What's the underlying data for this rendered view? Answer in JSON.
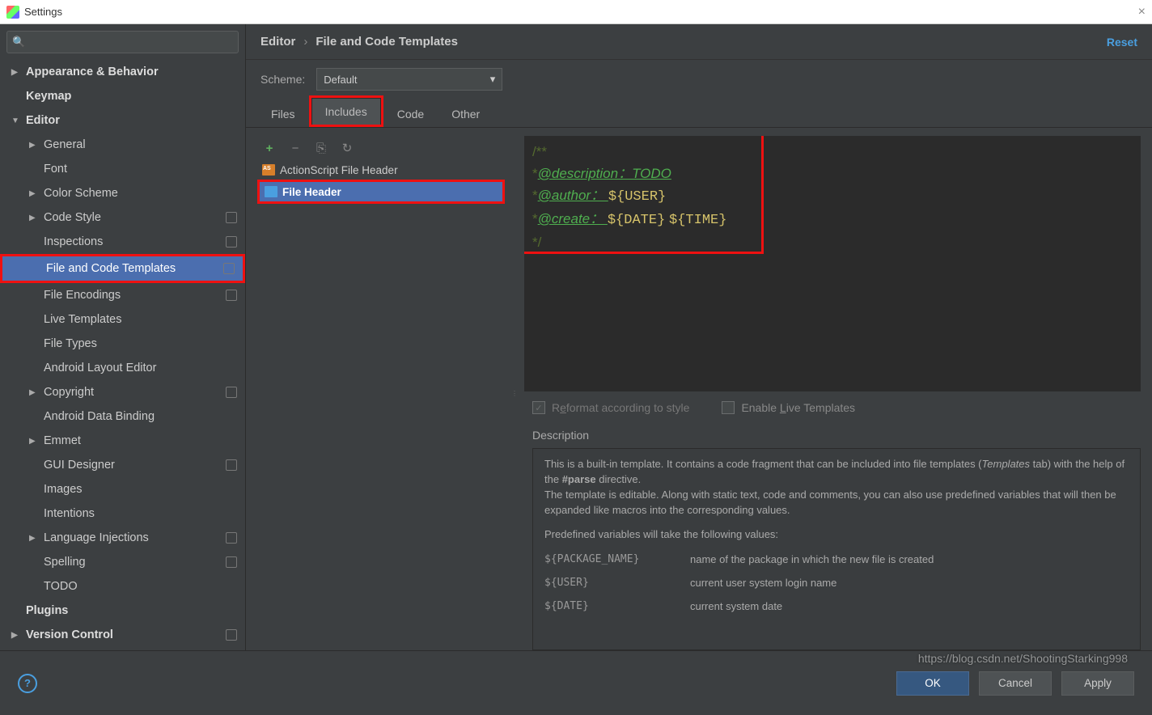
{
  "window": {
    "title": "Settings"
  },
  "search": {
    "placeholder": ""
  },
  "sidebar": [
    {
      "label": "Appearance & Behavior",
      "depth": 0,
      "chev": "▶",
      "bold": true
    },
    {
      "label": "Keymap",
      "depth": 0,
      "bold": true
    },
    {
      "label": "Editor",
      "depth": 0,
      "chev": "▼",
      "bold": true
    },
    {
      "label": "General",
      "depth": 1,
      "chev": "▶"
    },
    {
      "label": "Font",
      "depth": 1
    },
    {
      "label": "Color Scheme",
      "depth": 1,
      "chev": "▶"
    },
    {
      "label": "Code Style",
      "depth": 1,
      "chev": "▶",
      "badge": true
    },
    {
      "label": "Inspections",
      "depth": 1,
      "badge": true
    },
    {
      "label": "File and Code Templates",
      "depth": 1,
      "badge": true,
      "selected": true,
      "red": true
    },
    {
      "label": "File Encodings",
      "depth": 1,
      "badge": true
    },
    {
      "label": "Live Templates",
      "depth": 1
    },
    {
      "label": "File Types",
      "depth": 1
    },
    {
      "label": "Android Layout Editor",
      "depth": 1
    },
    {
      "label": "Copyright",
      "depth": 1,
      "chev": "▶",
      "badge": true
    },
    {
      "label": "Android Data Binding",
      "depth": 1
    },
    {
      "label": "Emmet",
      "depth": 1,
      "chev": "▶"
    },
    {
      "label": "GUI Designer",
      "depth": 1,
      "badge": true
    },
    {
      "label": "Images",
      "depth": 1
    },
    {
      "label": "Intentions",
      "depth": 1
    },
    {
      "label": "Language Injections",
      "depth": 1,
      "chev": "▶",
      "badge": true
    },
    {
      "label": "Spelling",
      "depth": 1,
      "badge": true
    },
    {
      "label": "TODO",
      "depth": 1
    },
    {
      "label": "Plugins",
      "depth": 0,
      "bold": true
    },
    {
      "label": "Version Control",
      "depth": 0,
      "chev": "▶",
      "bold": true,
      "badge": true
    }
  ],
  "breadcrumb": {
    "root": "Editor",
    "leaf": "File and Code Templates",
    "reset": "Reset"
  },
  "scheme": {
    "label": "Scheme:",
    "value": "Default"
  },
  "tabs": [
    {
      "label": "Files"
    },
    {
      "label": "Includes",
      "active": true,
      "red": true
    },
    {
      "label": "Code"
    },
    {
      "label": "Other"
    }
  ],
  "toolbar": {
    "add": "+",
    "remove": "−",
    "copy": "⎘",
    "refresh": "↻"
  },
  "list": [
    {
      "label": "ActionScript File Header",
      "icon": "as"
    },
    {
      "label": "File Header",
      "icon": "fh",
      "selected": true,
      "red": true
    }
  ],
  "editor_lines": [
    [
      {
        "t": "/**",
        "c": "c-dkgreen"
      }
    ],
    [
      {
        "t": "*",
        "c": "c-dkgreen"
      },
      {
        "t": "@description：TODO",
        "c": "c-green"
      }
    ],
    [
      {
        "t": "*",
        "c": "c-dkgreen"
      },
      {
        "t": "@author： ",
        "c": "c-green"
      },
      {
        "t": "${USER}",
        "c": "c-yellow"
      }
    ],
    [
      {
        "t": "*",
        "c": "c-dkgreen"
      },
      {
        "t": "@create： ",
        "c": "c-green"
      },
      {
        "t": "${DATE}",
        "c": "c-yellow"
      },
      {
        "t": " ",
        "c": ""
      },
      {
        "t": "${TIME}",
        "c": "c-yellow"
      }
    ],
    [
      {
        "t": "*/",
        "c": "c-dkgreen"
      }
    ]
  ],
  "options": {
    "reformat_pre": "R",
    "reformat_u": "e",
    "reformat_post": "format according to style",
    "reformat_checked": true,
    "reformat_disabled": true,
    "live_pre": "Enable ",
    "live_u": "L",
    "live_post": "ive Templates",
    "live_checked": false
  },
  "description": {
    "label": "Description",
    "para1a": "This is a built-in template. It contains a code fragment that can be included into file templates (",
    "para1em": "Templates",
    "para1b": " tab) with the help of the ",
    "para1bold": "#parse",
    "para1c": " directive.",
    "para2": "The template is editable. Along with static text, code and comments, you can also use predefined variables that will then be expanded like macros into the corresponding values.",
    "para3": "Predefined variables will take the following values:",
    "vars": [
      {
        "name": "${PACKAGE_NAME}",
        "desc": "name of the package in which the new file is created"
      },
      {
        "name": "${USER}",
        "desc": "current user system login name"
      },
      {
        "name": "${DATE}",
        "desc": "current system date"
      }
    ]
  },
  "footer": {
    "ok": "OK",
    "cancel": "Cancel",
    "apply": "Apply"
  },
  "watermark": "https://blog.csdn.net/ShootingStarking998"
}
